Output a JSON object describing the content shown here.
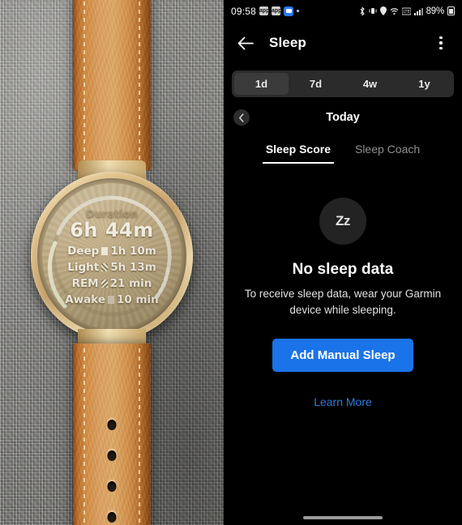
{
  "watch_photo": {
    "device_label": "garmin-watch-leather-strap",
    "face": {
      "heading": "Duration",
      "total": "6h 44m",
      "stages": [
        {
          "label": "Deep",
          "value": "1h 10m",
          "swatch": "deep-solid-swatch"
        },
        {
          "label": "Light",
          "value": "5h 13m",
          "swatch": "light-hatch-swatch"
        },
        {
          "label": "REM",
          "value": "21 min",
          "swatch": "rem-hatch-swatch"
        },
        {
          "label": "Awake",
          "value": "10 min",
          "swatch": "awake-solid-swatch"
        }
      ]
    },
    "colors": {
      "strap": "#d9a063",
      "case_gold": "#ddbe86",
      "screen": "#b8a47b",
      "fabric": "#8e8d88"
    }
  },
  "phone": {
    "status_bar": {
      "time": "09:58",
      "left_icons": [
        "app-chip-icon",
        "app-chip-icon",
        "message-bubble-icon",
        "more-dot-icon"
      ],
      "right_icons": [
        "bluetooth-icon",
        "vibrate-icon",
        "location-icon",
        "wifi-icon",
        "lte-icon",
        "signal-bars-icon"
      ],
      "battery_text": "89%",
      "battery_icon": "battery-icon"
    },
    "app_bar": {
      "back_icon": "back-arrow-icon",
      "title": "Sleep",
      "overflow_icon": "kebab-menu-icon"
    },
    "range_selector": {
      "options": [
        {
          "label": "1d",
          "selected": true
        },
        {
          "label": "7d",
          "selected": false
        },
        {
          "label": "4w",
          "selected": false
        },
        {
          "label": "1y",
          "selected": false
        }
      ]
    },
    "date_nav": {
      "prev_icon": "chevron-left-icon",
      "label": "Today"
    },
    "tabs": [
      {
        "label": "Sleep Score",
        "active": true
      },
      {
        "label": "Sleep Coach",
        "active": false
      }
    ],
    "empty_state": {
      "icon": "sleep-zz-icon",
      "icon_text": "Zz",
      "title": "No sleep data",
      "description": "To receive sleep data, wear your Garmin device while sleeping.",
      "primary_button": "Add Manual Sleep",
      "link": "Learn More"
    },
    "gesture_bar": "home-gesture-bar",
    "colors": {
      "background": "#000000",
      "accent_blue": "#1a73e8",
      "link_blue": "#2f7ce0",
      "segment_track": "#2b2b2b",
      "segment_active": "#3b3b3b",
      "muted_text": "#8e8e8e"
    }
  }
}
